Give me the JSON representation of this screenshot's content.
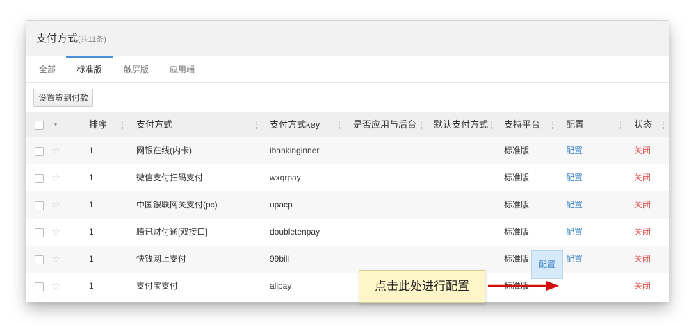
{
  "header": {
    "title": "支付方式",
    "count": "(共11条)"
  },
  "tabs": [
    "全部",
    "标准版",
    "触屏版",
    "应用端"
  ],
  "active_tab": "标准版",
  "toolbar": {
    "set_cod_label": "设置货到付款"
  },
  "table": {
    "headers": {
      "sort": "排序",
      "method": "支付方式",
      "key": "支付方式key",
      "admin_applied": "是否应用与后台",
      "default": "默认支付方式",
      "platform": "支持平台",
      "config": "配置",
      "status": "状态"
    },
    "rows": [
      {
        "sort": "1",
        "method": "网银在线(内卡)",
        "key": "ibankinginner",
        "platform": "标准版",
        "config": "配置",
        "status": "关闭"
      },
      {
        "sort": "1",
        "method": "微信支付扫码支付",
        "key": "wxqrpay",
        "platform": "标准版",
        "config": "配置",
        "status": "关闭"
      },
      {
        "sort": "1",
        "method": "中国银联网关支付(pc)",
        "key": "upacp",
        "platform": "标准版",
        "config": "配置",
        "status": "关闭"
      },
      {
        "sort": "1",
        "method": "腾讯财付通[双接口]",
        "key": "doubletenpay",
        "platform": "标准版",
        "config": "配置",
        "status": "关闭"
      },
      {
        "sort": "1",
        "method": "快钱网上支付",
        "key": "99bill",
        "platform": "标准版",
        "config": "配置",
        "status": "关闭"
      },
      {
        "sort": "1",
        "method": "支付宝支付",
        "key": "alipay",
        "platform": "标准版",
        "config": "配置",
        "status": "关闭"
      }
    ]
  },
  "callout": {
    "text": "点击此处进行配置"
  },
  "colors": {
    "link": "#3b83c6",
    "status_closed": "#d9534f",
    "tab_accent": "#4a90d9",
    "arrow": "#d01010",
    "callout_bg": "#fdf6c8"
  }
}
